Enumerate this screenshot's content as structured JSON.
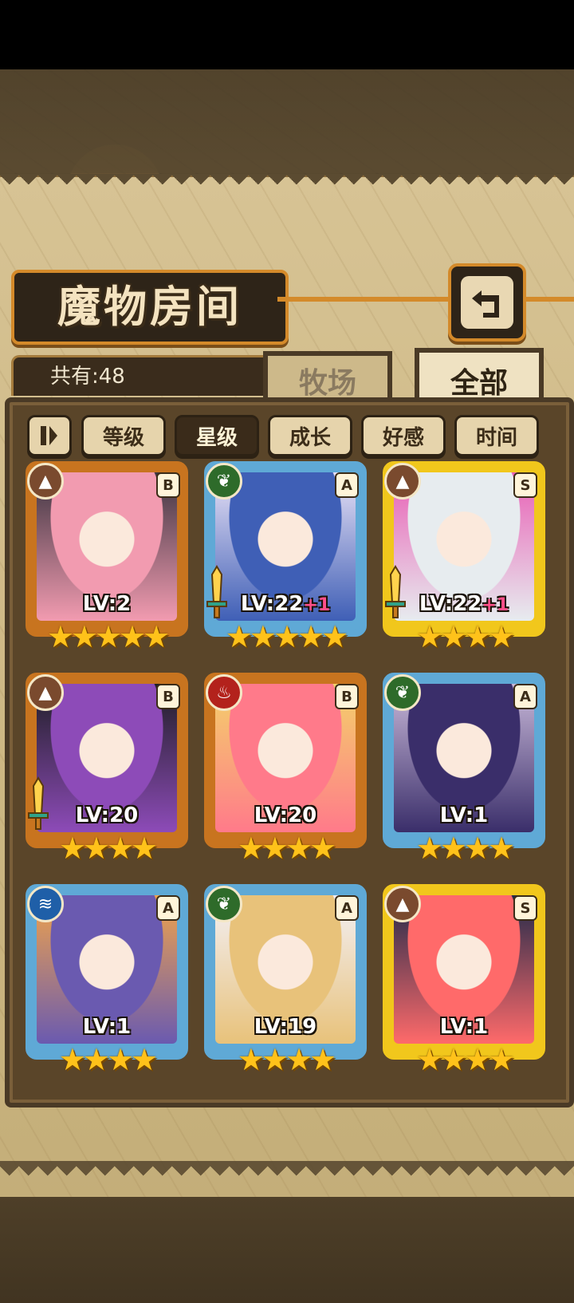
{
  "window": {
    "title": "魔物房间"
  },
  "count": {
    "label": "共有:48"
  },
  "tabs": [
    {
      "label": "牧场",
      "active": false
    },
    {
      "label": "全部",
      "active": true
    }
  ],
  "sort": {
    "toggle_icon": "pause-bars-icon",
    "buttons": [
      {
        "label": "等级",
        "active": false
      },
      {
        "label": "星级",
        "active": true
      },
      {
        "label": "成长",
        "active": false
      },
      {
        "label": "好感",
        "active": false
      },
      {
        "label": "时间",
        "active": false
      }
    ]
  },
  "monsters": [
    {
      "element": "earth",
      "rank": "B",
      "level": "LV:2",
      "bonus": "",
      "stars": "★★★★★",
      "frame": "bronze",
      "weapon": false,
      "art_colors": [
        "#f29bb0",
        "#3b3440"
      ]
    },
    {
      "element": "nature",
      "rank": "A",
      "level": "LV:22",
      "bonus": "+1",
      "stars": "★★★★★",
      "frame": "silver",
      "weapon": true,
      "art_colors": [
        "#3f5fb6",
        "#e9e2f6"
      ]
    },
    {
      "element": "earth",
      "rank": "S",
      "level": "LV:22",
      "bonus": "+1",
      "stars": "★★★★",
      "frame": "gold",
      "weapon": true,
      "art_colors": [
        "#e7ecef",
        "#e85fb5"
      ]
    },
    {
      "element": "earth",
      "rank": "B",
      "level": "LV:20",
      "bonus": "",
      "stars": "★★★★",
      "frame": "bronze",
      "weapon": true,
      "art_colors": [
        "#8d4bb8",
        "#1e1e24"
      ]
    },
    {
      "element": "fire",
      "rank": "B",
      "level": "LV:20",
      "bonus": "",
      "stars": "★★★★",
      "frame": "bronze",
      "weapon": false,
      "art_colors": [
        "#ff7a8a",
        "#f4d26a"
      ]
    },
    {
      "element": "nature",
      "rank": "A",
      "level": "LV:1",
      "bonus": "",
      "stars": "★★★★",
      "frame": "silver",
      "weapon": false,
      "art_colors": [
        "#3a2e6a",
        "#c9b9d9"
      ]
    },
    {
      "element": "water",
      "rank": "A",
      "level": "LV:1",
      "bonus": "",
      "stars": "★★★★",
      "frame": "silver",
      "weapon": false,
      "art_colors": [
        "#6a5ab0",
        "#f2a44a"
      ]
    },
    {
      "element": "nature",
      "rank": "A",
      "level": "LV:19",
      "bonus": "",
      "stars": "★★★★",
      "frame": "silver",
      "weapon": false,
      "art_colors": [
        "#e8c27a",
        "#f3f0f6"
      ]
    },
    {
      "element": "earth",
      "rank": "S",
      "level": "LV:1",
      "bonus": "",
      "stars": "★★★★",
      "frame": "gold",
      "weapon": false,
      "art_colors": [
        "#ff6a6a",
        "#1f2a4a"
      ]
    }
  ],
  "colors": {
    "bronze": "#c8741f",
    "silver": "#5fa9d6",
    "gold": "#f1c71c",
    "earth": "#7a4a2e",
    "nature": "#2e6b2a",
    "fire": "#b3221c",
    "water": "#1f5fa8"
  }
}
